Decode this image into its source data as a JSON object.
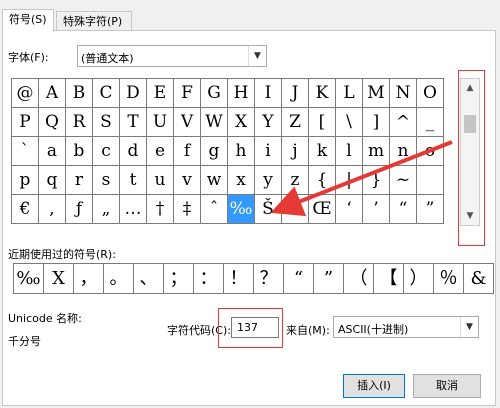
{
  "tabs": [
    {
      "label": "符号(S)",
      "active": true
    },
    {
      "label": "特殊字符(P)",
      "active": false
    }
  ],
  "font": {
    "label": "字体(F):",
    "value": "(普通文本)"
  },
  "symbols": [
    [
      "@",
      "A",
      "B",
      "C",
      "D",
      "E",
      "F",
      "G",
      "H",
      "I",
      "J",
      "K",
      "L",
      "M",
      "N",
      "O"
    ],
    [
      "P",
      "Q",
      "R",
      "S",
      "T",
      "U",
      "V",
      "W",
      "X",
      "Y",
      "Z",
      "[",
      "\\",
      "]",
      "^",
      "_"
    ],
    [
      "`",
      "a",
      "b",
      "c",
      "d",
      "e",
      "f",
      "g",
      "h",
      "i",
      "j",
      "k",
      "l",
      "m",
      "n",
      "o"
    ],
    [
      "p",
      "q",
      "r",
      "s",
      "t",
      "u",
      "v",
      "w",
      "x",
      "y",
      "z",
      "{",
      "|",
      "}",
      "~",
      ""
    ],
    [
      "€",
      ",",
      "ƒ",
      "„",
      "…",
      "†",
      "‡",
      "ˆ",
      "‰",
      "Š",
      "‹",
      "Œ",
      "‘",
      "’",
      "“",
      "”"
    ]
  ],
  "selected_symbol": "‰",
  "recent": {
    "label": "近期使用过的符号(R):",
    "items": [
      "‰",
      "X",
      "，",
      "。",
      "、",
      "；",
      "：",
      "！",
      "？",
      "“",
      "”",
      "（",
      "【",
      "）",
      "％",
      "&"
    ]
  },
  "unicode": {
    "label": "Unicode 名称:",
    "name": "千分号"
  },
  "char_code": {
    "label": "字符代码(C):",
    "value": "137"
  },
  "from": {
    "label": "来自(M):",
    "value": "ASCII(十进制)"
  },
  "buttons": {
    "insert": "插入(I)",
    "cancel": "取消"
  },
  "colors": {
    "selection": "#3399ff",
    "annotation": "#e53935"
  }
}
